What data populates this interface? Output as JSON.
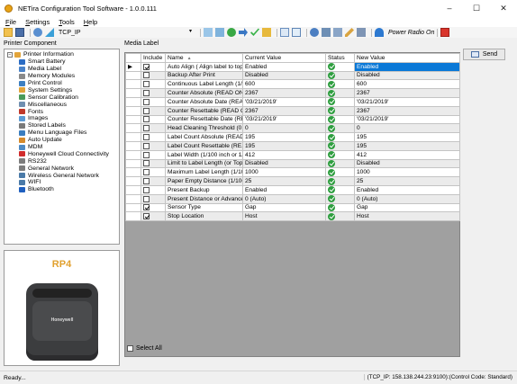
{
  "window": {
    "title": "NETira Configuration Tool Software - 1.0.0.111",
    "controls": [
      "–",
      "☐",
      "✕"
    ]
  },
  "menu": [
    {
      "label": "File",
      "accel": "F",
      "rest": "ile"
    },
    {
      "label": "Settings",
      "accel": "S",
      "rest": "ettings"
    },
    {
      "label": "Tools",
      "accel": "T",
      "rest": "ools"
    },
    {
      "label": "Help",
      "accel": "H",
      "rest": "elp"
    }
  ],
  "toolbar": {
    "connection": "TCP_IP",
    "power_radio": "Power Radio On"
  },
  "left_panel": {
    "title": "Printer Component",
    "tree": {
      "root": "Printer Information",
      "items": [
        {
          "label": "Smart Battery",
          "color": "#2b6cc4"
        },
        {
          "label": "Media Label",
          "color": "#4a83c9"
        },
        {
          "label": "Memory Modules",
          "color": "#8a8a8a"
        },
        {
          "label": "Print Control",
          "color": "#3d7fc1"
        },
        {
          "label": "System Settings",
          "color": "#e2a43a"
        },
        {
          "label": "Sensor Calibration",
          "color": "#4a9a5a"
        },
        {
          "label": "Miscellaneous",
          "color": "#6f8fb0"
        },
        {
          "label": "Fonts",
          "color": "#c0392b"
        },
        {
          "label": "Images",
          "color": "#5b9bd5"
        },
        {
          "label": "Stored Labels",
          "color": "#7a7a7a"
        },
        {
          "label": "Menu Language Files",
          "color": "#3a7dbf"
        },
        {
          "label": "Auto Update",
          "color": "#d58a2b"
        },
        {
          "label": "MDM",
          "color": "#4e8ac4"
        },
        {
          "label": "Honeywell Cloud Connectivity",
          "color": "#d02c2c"
        },
        {
          "label": "RS232",
          "color": "#7d7d7d"
        },
        {
          "label": "General Network",
          "color": "#7d7d7d"
        },
        {
          "label": "Wireless General Network",
          "color": "#4a7aa8"
        },
        {
          "label": "WIFI",
          "color": "#4a7aa8"
        },
        {
          "label": "Bluetooth",
          "color": "#1f5fbf"
        }
      ]
    },
    "device": {
      "model": "RP4",
      "brand": "Honeywell"
    }
  },
  "media_label": {
    "title": "Media Label",
    "columns": [
      "Include",
      "Name",
      "Current Value",
      "Status",
      "New Value"
    ],
    "rows": [
      {
        "include": true,
        "name": "Auto Align ( Align label to top ...",
        "current": "Enabled",
        "new": "Enabled",
        "selected": true
      },
      {
        "include": false,
        "name": "Backup After Print",
        "current": "Disabled",
        "new": "Disabled"
      },
      {
        "include": false,
        "name": "Continuous Label Length (1/...",
        "current": "600",
        "new": "600"
      },
      {
        "include": false,
        "name": "Counter Absolute (READ ON...",
        "current": "2367",
        "new": "2367"
      },
      {
        "include": false,
        "name": "Counter Absolute Date (REA...",
        "current": "'03/21/2019'",
        "new": "'03/21/2019'"
      },
      {
        "include": false,
        "name": "Counter Resettable (READ O...",
        "current": "2367",
        "new": "2367"
      },
      {
        "include": false,
        "name": "Counter Resettable Date (RE...",
        "current": "'03/21/2019'",
        "new": "'03/21/2019'"
      },
      {
        "include": false,
        "name": "Head Cleaning Threshold (0 ...",
        "current": "0",
        "new": "0"
      },
      {
        "include": false,
        "name": "Label Count Absolute (READ ...",
        "current": "195",
        "new": "195"
      },
      {
        "include": false,
        "name": "Label Count Resettable (RE...",
        "current": "195",
        "new": "195"
      },
      {
        "include": false,
        "name": "Label Width (1/100 inch or 1/...",
        "current": "412",
        "new": "412"
      },
      {
        "include": false,
        "name": "Limit to Label Length (or Top ...",
        "current": "Disabled",
        "new": "Disabled"
      },
      {
        "include": false,
        "name": "Maximum Label Length (1/10...",
        "current": "1000",
        "new": "1000"
      },
      {
        "include": false,
        "name": "Paper Empty Distance (1/100...",
        "current": "25",
        "new": "25"
      },
      {
        "include": false,
        "name": "Present Backup",
        "current": "Enabled",
        "new": "Enabled"
      },
      {
        "include": false,
        "name": "Present Distance or Advance ...",
        "current": "0 (Auto)",
        "new": "0 (Auto)"
      },
      {
        "include": true,
        "name": "Sensor Type",
        "current": "Gap",
        "new": "Gap"
      },
      {
        "include": true,
        "name": "Stop Location",
        "current": "Host",
        "new": "Host"
      }
    ],
    "select_all": "Select All"
  },
  "actions": {
    "send": "Send"
  },
  "status": {
    "left": "Ready...",
    "right": "(TCP_IP: 158.138.244.23:9100):(Control Code: Standard)"
  }
}
